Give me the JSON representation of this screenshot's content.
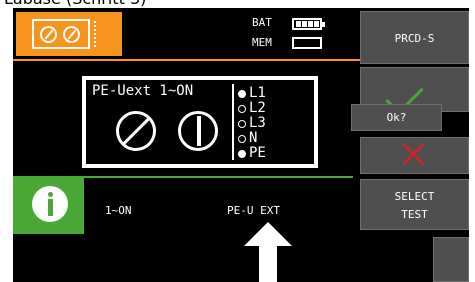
{
  "heading": {
    "text": "Labase (Schritt 3)"
  },
  "status": {
    "bat_label": "BAT",
    "mem_label": "MEM",
    "battery_cells": 4,
    "battery_level": 1.0
  },
  "panel": {
    "title": "PE-Uext 1~ON",
    "phases": [
      {
        "label": "L1",
        "selected": true
      },
      {
        "label": "L2",
        "selected": false
      },
      {
        "label": "L3",
        "selected": false
      },
      {
        "label": "N",
        "selected": false
      },
      {
        "label": "PE",
        "selected": true
      }
    ]
  },
  "info": {
    "mode": "1~ON",
    "measurement": "PE-U EXT"
  },
  "sidebar": {
    "prcd_label": "PRCD-S",
    "ok_label": "Ok?",
    "select_label": "SELECT",
    "test_label": "TEST"
  },
  "colors": {
    "accent": "#f7941d",
    "confirm": "#4aa836",
    "cancel": "#c62828",
    "button": "#4f4f4f"
  },
  "icons": [
    "meter-logo-icon",
    "battery-icon",
    "memory-icon",
    "slash-symbol-icon",
    "bar-symbol-icon",
    "info-icon",
    "check-icon",
    "cross-icon",
    "arrow-up-icon"
  ]
}
